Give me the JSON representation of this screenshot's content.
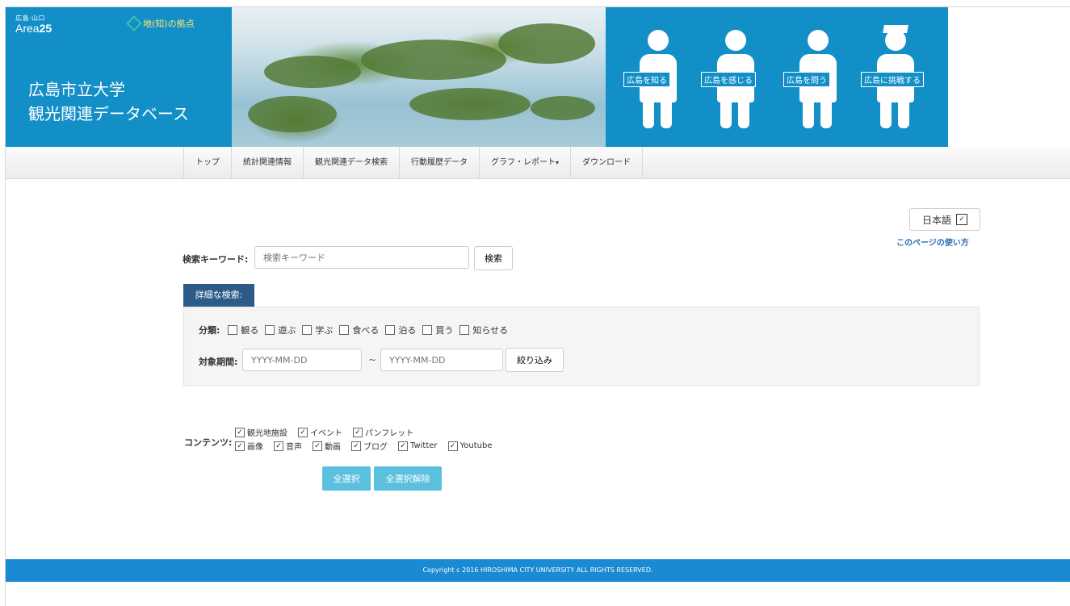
{
  "header": {
    "small_text": "広島·山口",
    "area_prefix": "Area",
    "area_number": "25",
    "chino_text": "地(知)の拠点",
    "title_line1": "広島市立大学",
    "title_line2": "観光関連データベース",
    "figures": [
      {
        "label": "広島を知る",
        "icon": "person-with-bag-icon"
      },
      {
        "label": "広島を感じる",
        "icon": "person-with-pointer-icon"
      },
      {
        "label": "広島を問う",
        "icon": "person-raising-hand-icon"
      },
      {
        "label": "広島に挑戦する",
        "icon": "graduate-icon"
      }
    ]
  },
  "nav": {
    "items": [
      "トップ",
      "統計関連情報",
      "観光関連データ検索",
      "行動履歴データ",
      "グラフ・レポート",
      "ダウンロード"
    ],
    "dropdown_caret": "▾"
  },
  "lang": {
    "selected": "日本語",
    "arrow": "✓"
  },
  "howto_link": "このページの使い方",
  "search": {
    "label": "検索キーワード:",
    "placeholder": "検索キーワード",
    "button": "検索"
  },
  "advanced": {
    "tab_label": "詳細な検索:",
    "category_label": "分類:",
    "categories": [
      "観る",
      "遊ぶ",
      "学ぶ",
      "食べる",
      "泊る",
      "買う",
      "知らせる"
    ],
    "period_label": "対象期間:",
    "date_placeholder": "YYYY-MM-DD",
    "tilde": "~",
    "filter_button": "絞り込み"
  },
  "contents": {
    "label": "コンテンツ:",
    "row1": [
      "観光地施設",
      "イベント",
      "パンフレット"
    ],
    "row2": [
      "画像",
      "音声",
      "動画",
      "ブログ",
      "Twitter",
      "Youtube"
    ],
    "check_mark": "✓"
  },
  "buttons": {
    "select_all": "全選択",
    "deselect_all": "全選択解除"
  },
  "footer": {
    "copyright": "Copyright c 2016 HIROSHIMA CITY UNIVERSITY ALL RIGHTS RESERVED."
  }
}
